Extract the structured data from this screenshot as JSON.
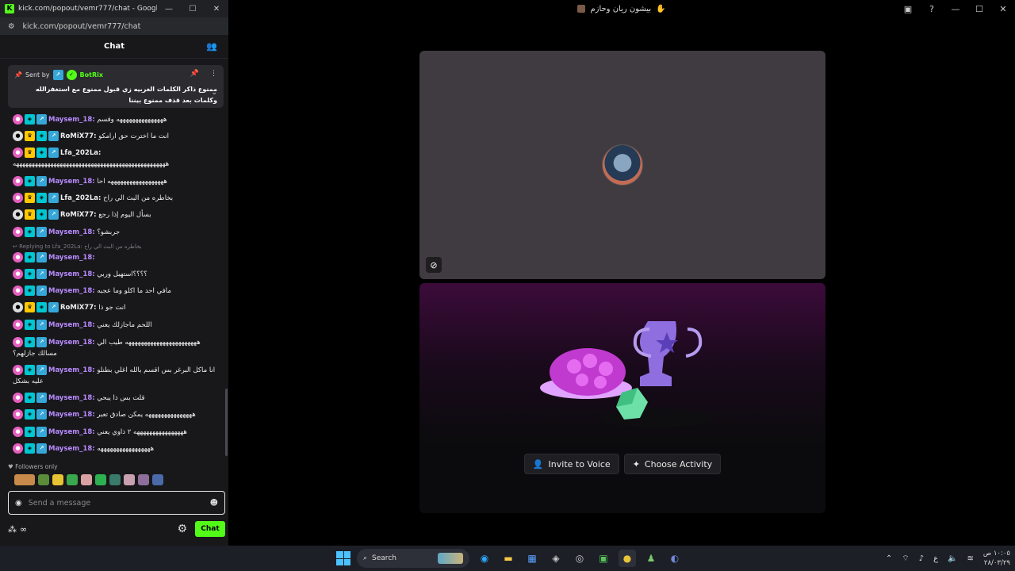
{
  "chrome": {
    "title": "kick.com/popout/vemr777/chat - Google Chro...",
    "url": "kick.com/popout/vemr777/chat",
    "min": "—",
    "max": "☐",
    "close": "✕"
  },
  "chat": {
    "header": "Chat",
    "pinned": {
      "sent_by": "Sent by",
      "bot": "BotRix",
      "text": "ممنوع ذاكر الكلمات الغربيه زي قبول ممنوع مع استغفرالله وكلمات بعد قذف ممنوع بيننا"
    },
    "messages": [
      {
        "user": "Maysem_18",
        "text": "هههههههههههههههه وقسم",
        "color": "purple",
        "badges": [
          "sub",
          "og",
          "kick"
        ]
      },
      {
        "user": "RoMiX77",
        "text": "انت ما اخترت حق ارامكو",
        "color": "white",
        "badges": [
          "gray",
          "vip",
          "og",
          "kick"
        ]
      },
      {
        "user": "Lfa_202La",
        "text": "هههههههههههههههههههههههههههههههههههههههههههههههههه",
        "color": "white",
        "badges": [
          "sub",
          "vip",
          "og",
          "kick"
        ]
      },
      {
        "user": "Maysem_18",
        "text": "ههههههههههههههههههه احا",
        "color": "purple",
        "badges": [
          "sub",
          "og",
          "kick"
        ]
      },
      {
        "user": "Lfa_202La",
        "text": "بخاطره من البث الي راح",
        "color": "white",
        "badges": [
          "sub",
          "vip",
          "og",
          "kick"
        ]
      },
      {
        "user": "RoMiX77",
        "text": "بسأل اليوم إذا رجع",
        "color": "white",
        "badges": [
          "gray",
          "vip",
          "og",
          "kick"
        ]
      },
      {
        "user": "Maysem_18",
        "text": "جربشو؟",
        "color": "purple",
        "badges": [
          "sub",
          "og",
          "kick"
        ]
      },
      {
        "user": "Maysem_18",
        "text": "",
        "color": "purple",
        "badges": [
          "sub",
          "og",
          "kick"
        ]
      },
      {
        "user": "Maysem_18",
        "text": "؟؟؟؟استهبل وربي",
        "color": "purple",
        "badges": [
          "sub",
          "og",
          "kick"
        ]
      },
      {
        "user": "Maysem_18",
        "text": "مافي احد ما اكلو وما عجبه",
        "color": "purple",
        "badges": [
          "sub",
          "og",
          "kick"
        ]
      },
      {
        "user": "RoMiX77",
        "text": "انت جو ذا",
        "color": "white",
        "badges": [
          "gray",
          "vip",
          "og",
          "kick"
        ]
      },
      {
        "user": "Maysem_18",
        "text": "اللحم ماجازلك يعني",
        "color": "purple",
        "badges": [
          "sub",
          "og",
          "kick"
        ]
      },
      {
        "user": "Maysem_18",
        "text": "هههههههههههههههههههههههه طيب الي مسالك جازلهم؟",
        "color": "purple",
        "badges": [
          "sub",
          "og",
          "kick"
        ]
      },
      {
        "user": "Maysem_18",
        "text": "انا ماكل البرغر بس اقسم بالله اغلي بطنلو عليه بشكل",
        "color": "purple",
        "badges": [
          "sub",
          "og",
          "kick"
        ]
      },
      {
        "user": "Maysem_18",
        "text": "قلت بس ذا يبحي",
        "color": "purple",
        "badges": [
          "sub",
          "og",
          "kick"
        ]
      },
      {
        "user": "Maysem_18",
        "text": "هههههههههههههههه يمكن صادق تعبر",
        "color": "purple",
        "badges": [
          "sub",
          "og",
          "kick"
        ]
      },
      {
        "user": "Maysem_18",
        "text": "ههههههههههههههههه ٢ ذاوي يعني",
        "color": "purple",
        "badges": [
          "sub",
          "og",
          "kick"
        ]
      },
      {
        "user": "Maysem_18",
        "text": "هههههههههههههههههه",
        "color": "purple",
        "badges": [
          "sub",
          "og",
          "kick"
        ]
      }
    ],
    "replies": [
      {
        "text": "Replying to Lfa_202La: بخاطره من البث الي راح"
      }
    ],
    "followers_only": "Followers only",
    "input_placeholder": "Send a message",
    "chat_button": "Chat"
  },
  "discord": {
    "title": "بيشون ريان وحازم",
    "invite": "Invite to Voice",
    "choose": "Choose Activity"
  },
  "taskbar": {
    "search": "Search",
    "lang": "ع",
    "time": "١٠:٠٥ ص",
    "date": "٢٨/٠٣/٢٩"
  }
}
